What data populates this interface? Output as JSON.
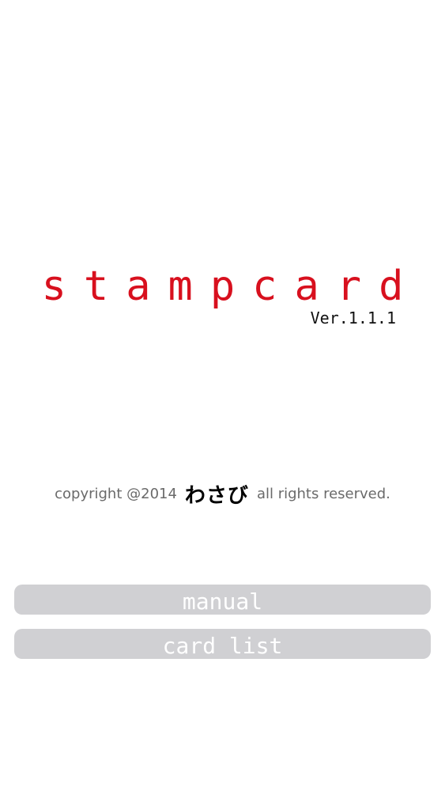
{
  "app": {
    "title": "stampcard",
    "version": "Ver.1.1.1"
  },
  "copyright": {
    "prefix": "copyright @2014",
    "brand": "わさび",
    "suffix": "all rights reserved."
  },
  "buttons": {
    "manual": "manual",
    "card_list": "card list"
  },
  "colors": {
    "title": "#d8101e",
    "button_bg": "#d0d0d3",
    "button_text": "#ffffff"
  }
}
